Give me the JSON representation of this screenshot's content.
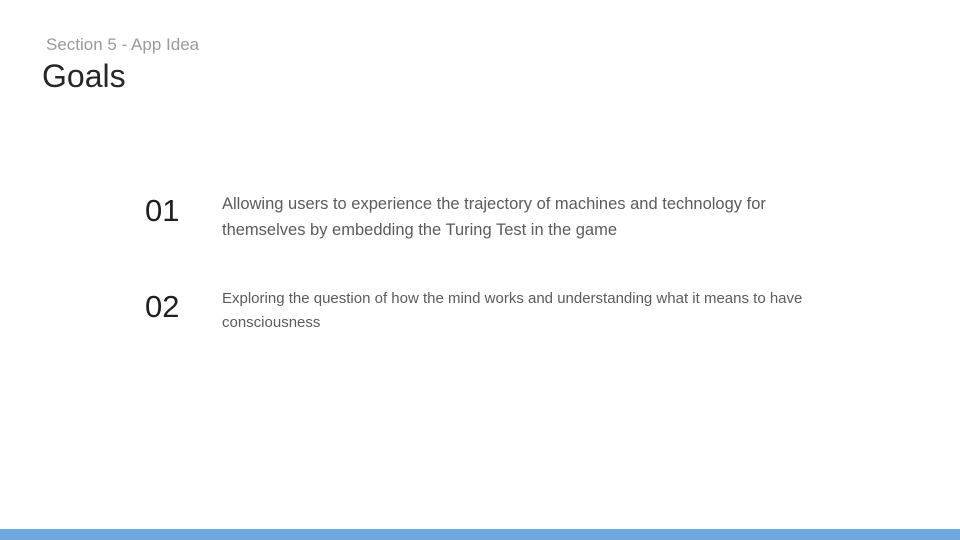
{
  "slide": {
    "section_label": "Section 5 - App Idea",
    "title": "Goals",
    "goals": [
      {
        "number": "01",
        "text": "Allowing users to experience the trajectory of machines and technology for themselves by embedding the Turing Test in the game"
      },
      {
        "number": "02",
        "text": "Exploring the question of how the mind works and understanding what it means to have consciousness"
      }
    ],
    "footer_bar_color": "#6fa8dc"
  }
}
